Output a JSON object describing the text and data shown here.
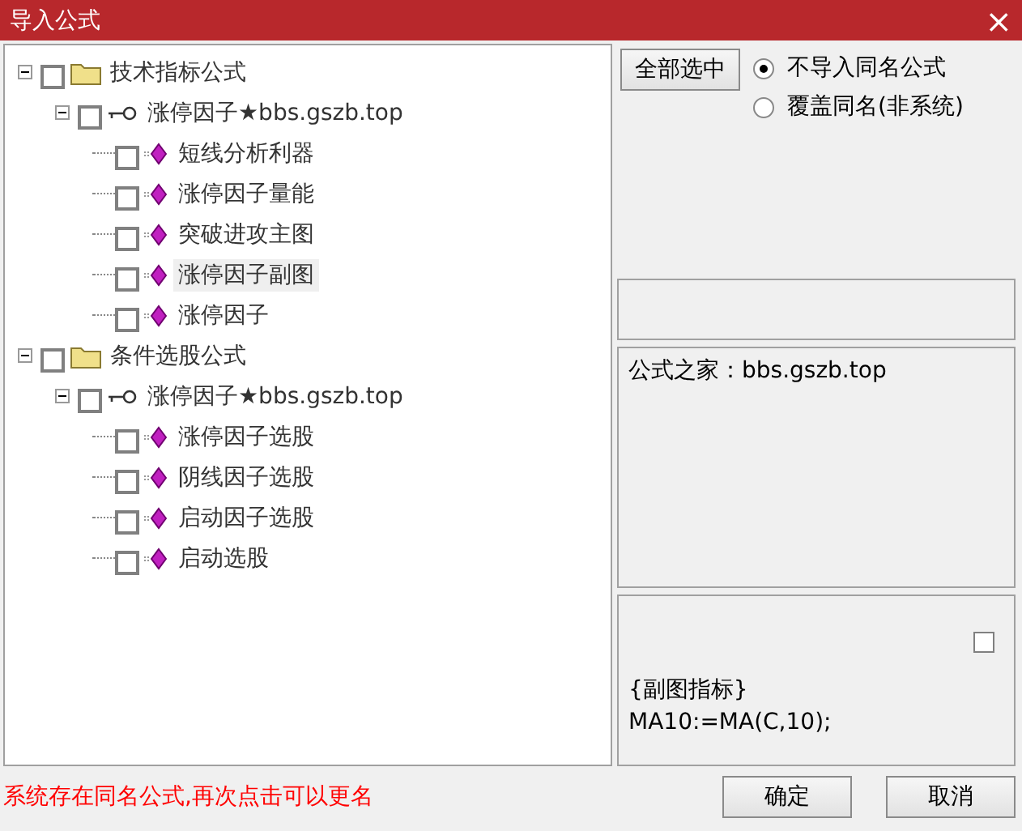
{
  "window": {
    "title": "导入公式",
    "close": "×"
  },
  "tree": [
    {
      "label": "技术指标公式",
      "kind": "folder",
      "checked": false,
      "expanded": true,
      "selected": false,
      "children": [
        {
          "label": "涨停因子★bbs.gszb.top",
          "kind": "group",
          "checked": false,
          "expanded": true,
          "selected": false,
          "children": [
            {
              "label": "短线分析利器",
              "kind": "formula",
              "checked": false,
              "selected": false
            },
            {
              "label": "涨停因子量能",
              "kind": "formula",
              "checked": false,
              "selected": false
            },
            {
              "label": "突破进攻主图",
              "kind": "formula",
              "checked": false,
              "selected": false
            },
            {
              "label": "涨停因子副图",
              "kind": "formula",
              "checked": false,
              "selected": true
            },
            {
              "label": "涨停因子",
              "kind": "formula",
              "checked": false,
              "selected": false
            }
          ]
        }
      ]
    },
    {
      "label": "条件选股公式",
      "kind": "folder",
      "checked": false,
      "expanded": true,
      "selected": false,
      "children": [
        {
          "label": "涨停因子★bbs.gszb.top",
          "kind": "group",
          "checked": false,
          "expanded": true,
          "selected": false,
          "children": [
            {
              "label": "涨停因子选股",
              "kind": "formula",
              "checked": false,
              "selected": false
            },
            {
              "label": "阴线因子选股",
              "kind": "formula",
              "checked": false,
              "selected": false
            },
            {
              "label": "启动因子选股",
              "kind": "formula",
              "checked": false,
              "selected": false
            },
            {
              "label": "启动选股",
              "kind": "formula",
              "checked": false,
              "selected": false
            }
          ]
        }
      ]
    }
  ],
  "select_all_button": "全部选中",
  "options": [
    {
      "label": "不导入同名公式",
      "selected": true
    },
    {
      "label": "覆盖同名(非系统)",
      "selected": false
    }
  ],
  "info_text": "公式之家：bbs.gszb.top",
  "preview": {
    "checked": false,
    "lines": [
      "{副图指标}",
      "MA10:=MA(C,10);"
    ]
  },
  "status_message": "系统存在同名公式,再次点击可以更名",
  "buttons": [
    "确定",
    "取消"
  ]
}
